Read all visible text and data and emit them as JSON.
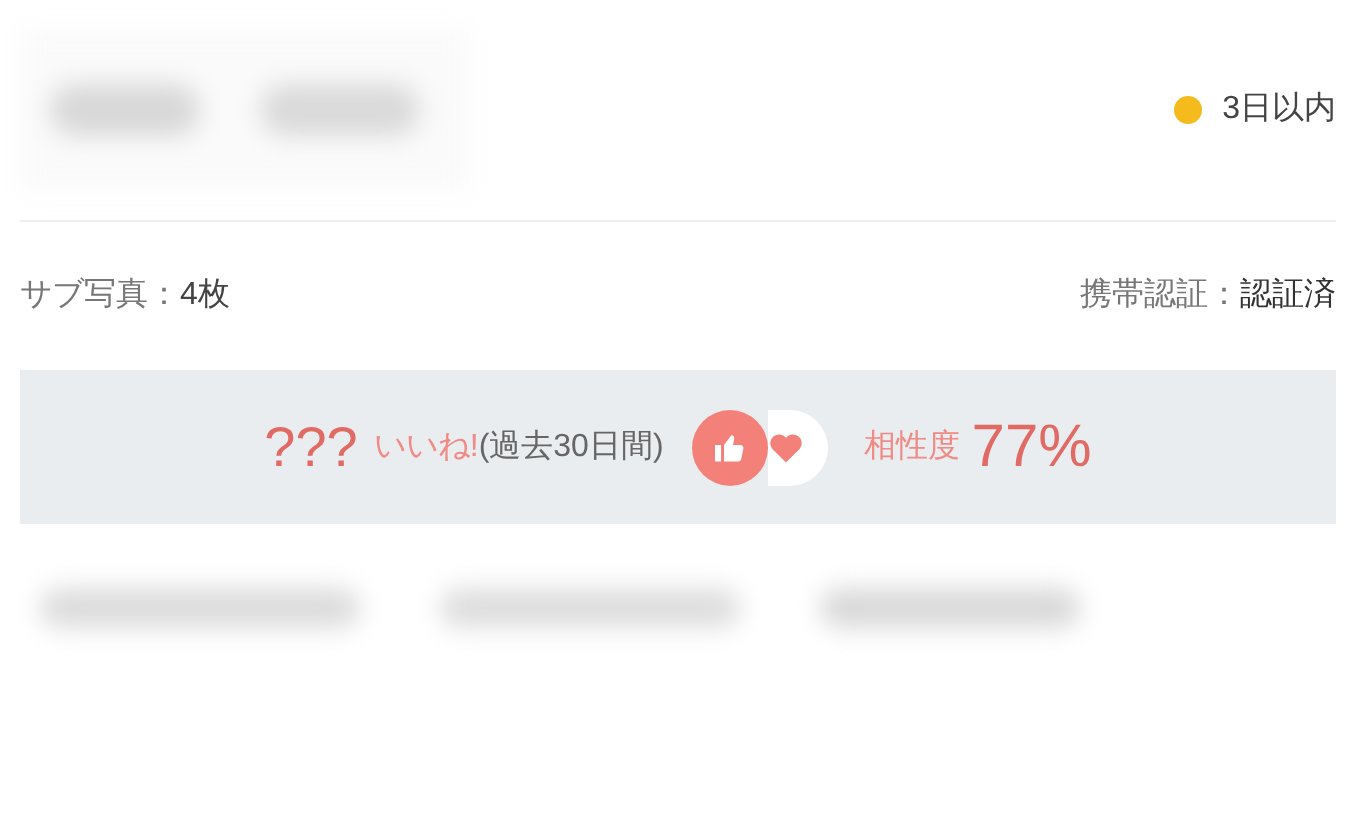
{
  "status": {
    "label": "3日以内",
    "color": "#f5bb1d"
  },
  "info": {
    "photos_label": "サブ写真：",
    "photos_value": "4枚",
    "phone_label": "携帯認証：",
    "phone_value": "認証済"
  },
  "likes": {
    "count": "???",
    "like_label": "いいね!",
    "period": "(過去30日間)",
    "compat_label": "相性度",
    "compat_value": "77%"
  }
}
